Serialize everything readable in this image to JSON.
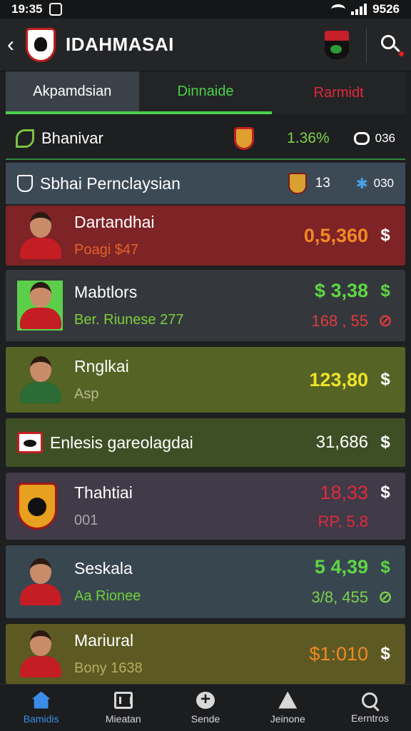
{
  "status": {
    "time": "19:35",
    "right_text": "9526"
  },
  "header": {
    "title": "IDAHMASAI"
  },
  "tabs": [
    {
      "label": "Akpamdsian"
    },
    {
      "label": "Dinnaide"
    },
    {
      "label": "Rarmidt"
    }
  ],
  "summary": {
    "label": "Bhanivar",
    "percent": "1.36%",
    "count": "036"
  },
  "section": {
    "title": "Sbhai Pernclaysian",
    "num": "13",
    "num2": "030"
  },
  "cards": [
    {
      "name": "Dartandhai",
      "sub": "Poagi $47",
      "sub_color": "#e0642a",
      "value": "0,5,360",
      "value_color": "#f08a24",
      "dollar": "$"
    },
    {
      "name": "Mabtlors",
      "sub": "Ber. Riunese 277",
      "sub_color": "#7dcf3a",
      "value": "$ 3,38",
      "value_color": "#5fd645",
      "dollar": "$",
      "value2": "168 , 55",
      "value2_color": "#e03a3a"
    },
    {
      "name": "Rnglkai",
      "sub": "Asp",
      "sub_color": "#b7b98e",
      "value": "123,80",
      "value_color": "#f0e22a",
      "dollar": "$"
    },
    {
      "name": "Enlesis gareolagdai",
      "value": "31,686",
      "value_color": "#ffffff",
      "dollar": "$"
    },
    {
      "name": "Thahtiai",
      "sub": "001",
      "sub_color": "#a8a8a8",
      "value": "18,33",
      "value_color": "#e02a3a",
      "dollar": "$",
      "value2": "RP, 5.8",
      "value2_color": "#e02a3a"
    },
    {
      "name": "Seskala",
      "sub": "Aa Rionee",
      "sub_color": "#6fcf3a",
      "value": "5 4,39",
      "value_color": "#5fd645",
      "dollar": "$",
      "value2": "3/8, 455",
      "value2_color": "#7dd34a"
    },
    {
      "name": "Mariural",
      "sub": "Bony 1638",
      "sub_color": "#b8ad5e",
      "value": "$1:010",
      "value_color": "#f08a24",
      "dollar": "$"
    }
  ],
  "nav": [
    {
      "label": "Bamidis"
    },
    {
      "label": "Mieatan"
    },
    {
      "label": "Sende"
    },
    {
      "label": "Jeinone"
    },
    {
      "label": "Eerntros"
    }
  ]
}
